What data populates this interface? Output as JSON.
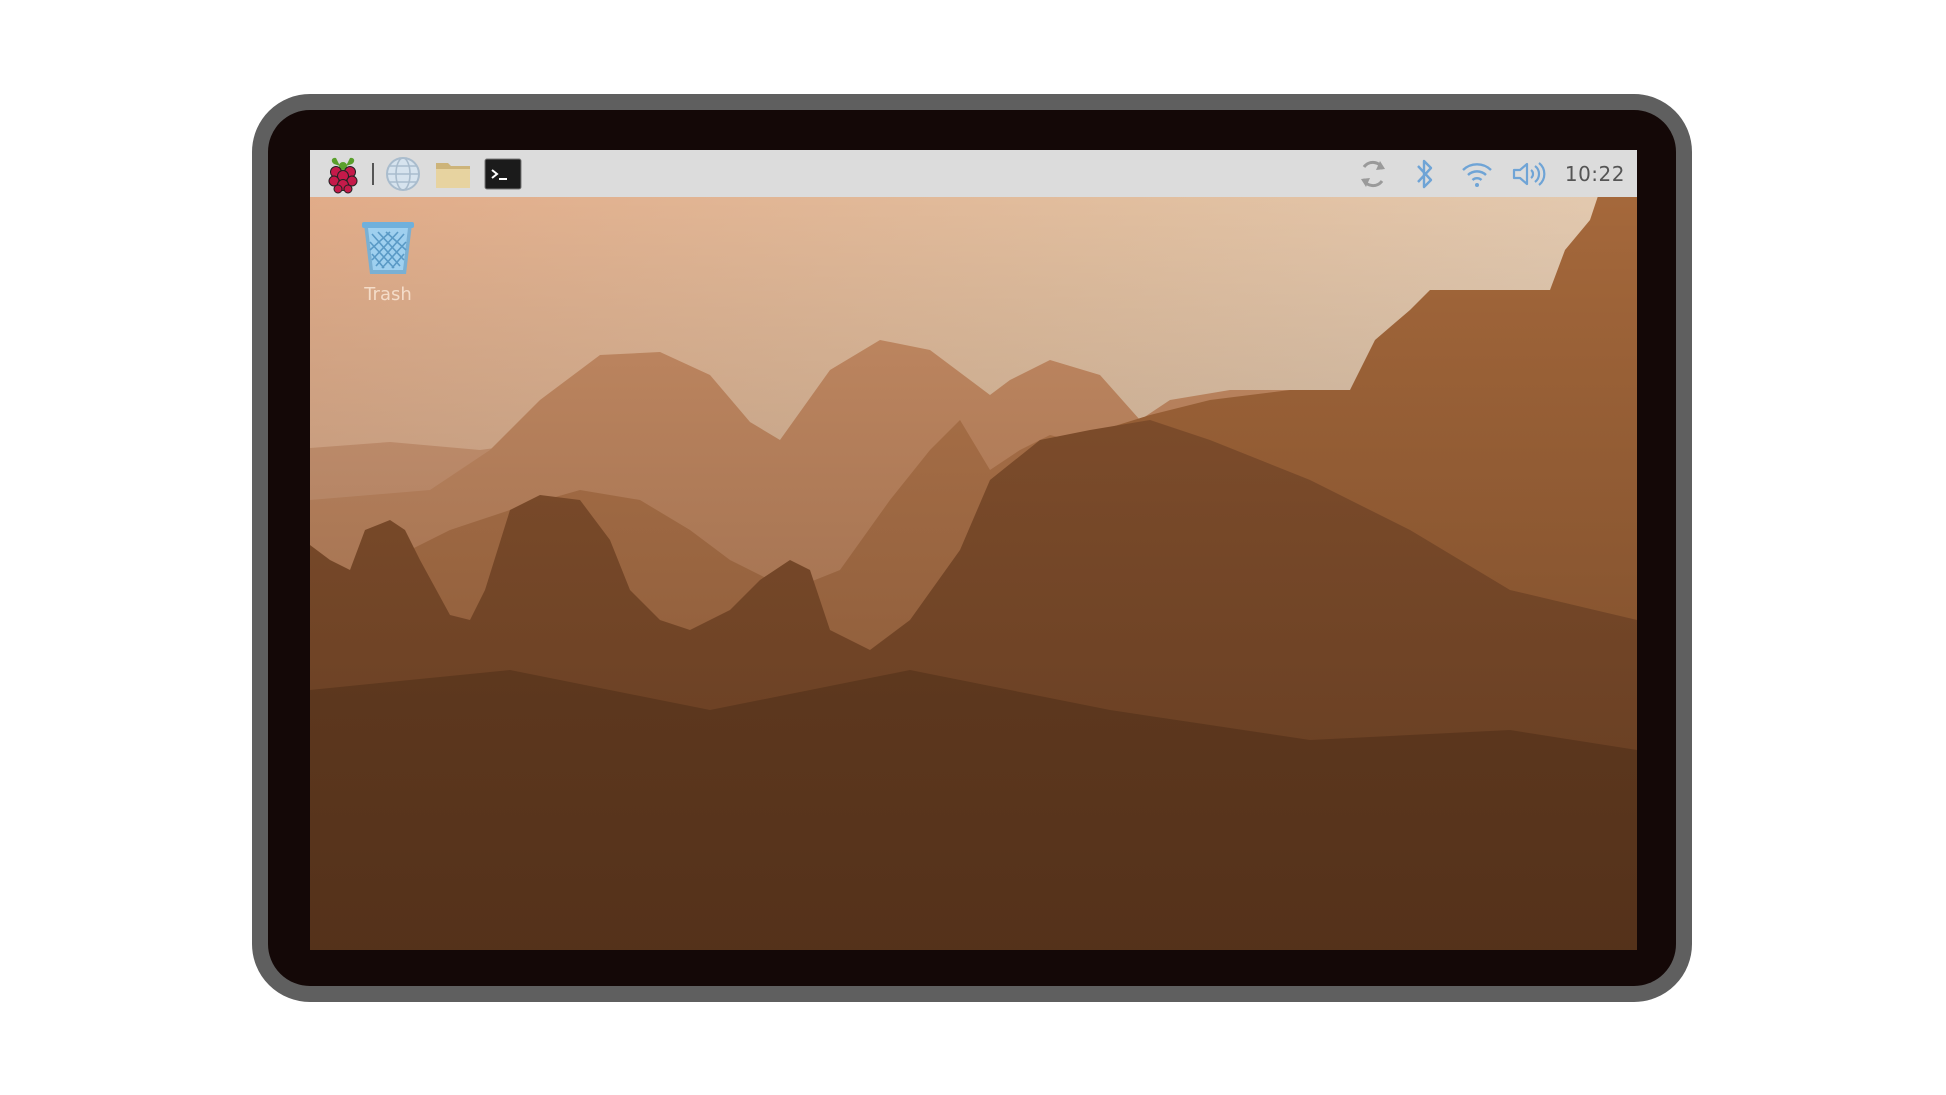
{
  "taskbar": {
    "launchers": [
      {
        "name": "raspberry-pi-menu-icon"
      },
      {
        "name": "web-browser-icon"
      },
      {
        "name": "file-manager-icon"
      },
      {
        "name": "terminal-icon"
      }
    ],
    "tray": [
      {
        "name": "updater-icon"
      },
      {
        "name": "bluetooth-icon"
      },
      {
        "name": "wifi-icon"
      },
      {
        "name": "volume-icon"
      }
    ],
    "clock": "10:22"
  },
  "desktop": {
    "icons": [
      {
        "label": "Trash",
        "icon": "trash-icon"
      }
    ]
  },
  "colors": {
    "taskbar_bg": "#dcdcdc",
    "tray_icon": "#6fa4d6",
    "device_bezel": "#5f5f5f",
    "sky_light": "#ead5bd",
    "mountain_dark": "#5e3a1e"
  }
}
